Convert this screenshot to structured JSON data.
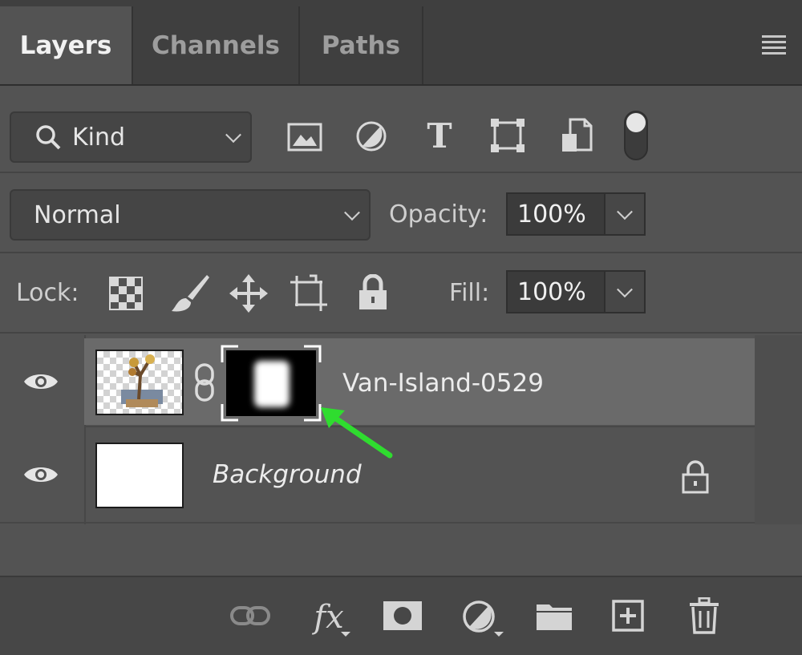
{
  "tabs": [
    {
      "label": "Layers",
      "active": true
    },
    {
      "label": "Channels",
      "active": false
    },
    {
      "label": "Paths",
      "active": false
    }
  ],
  "filter": {
    "kind_label": "Kind",
    "icons": [
      "image-filter-icon",
      "adjustment-filter-icon",
      "type-filter-icon",
      "shape-filter-icon",
      "smart-object-filter-icon",
      "filter-toggle-icon"
    ]
  },
  "blend": {
    "mode": "Normal",
    "opacity_label": "Opacity:",
    "opacity_value": "100%"
  },
  "lock": {
    "label": "Lock:",
    "fill_label": "Fill:",
    "fill_value": "100%"
  },
  "layers": [
    {
      "name": "Van-Island-0529",
      "visible": true,
      "selected": true,
      "has_mask": true
    },
    {
      "name": "Background",
      "visible": true,
      "selected": false,
      "locked": true
    }
  ],
  "bottom_icons": [
    "link-layers-icon",
    "fx-icon",
    "add-mask-icon",
    "adjustment-layer-icon",
    "group-folder-icon",
    "new-layer-icon",
    "trash-icon"
  ],
  "colors": {
    "panel_bg": "#535353",
    "selected_row": "#6a6a6a",
    "annotation_arrow": "#2fdc2f"
  }
}
